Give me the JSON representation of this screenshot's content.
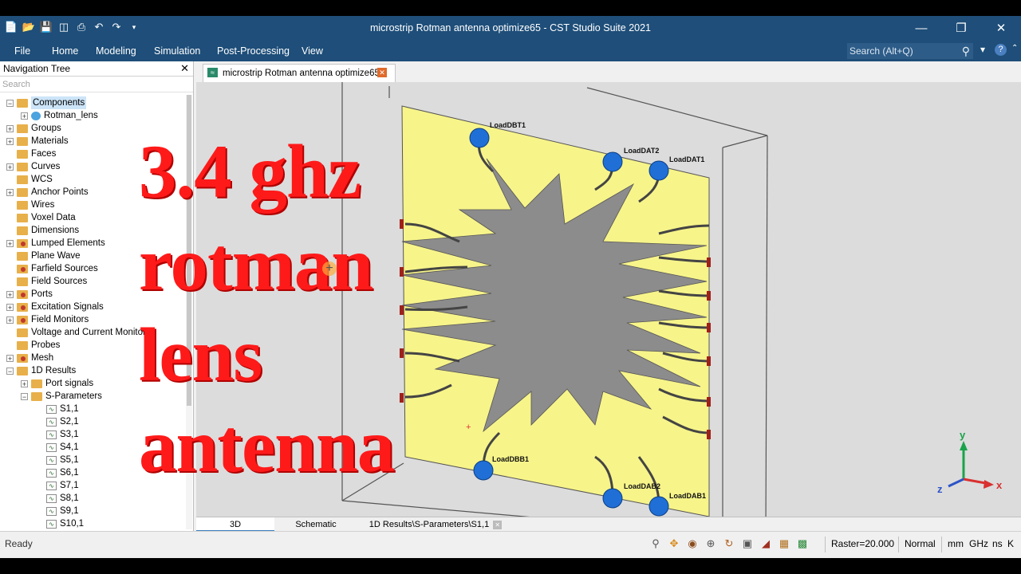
{
  "window": {
    "title": "microstrip Rotman antenna optimize65 - CST Studio Suite 2021"
  },
  "menu": {
    "items": [
      "File",
      "Home",
      "Modeling",
      "Simulation",
      "Post-Processing",
      "View"
    ],
    "search_placeholder": "Search (Alt+Q)"
  },
  "nav": {
    "title": "Navigation Tree",
    "search_placeholder": "Search",
    "items": [
      "Components",
      "Rotman_lens",
      "Groups",
      "Materials",
      "Faces",
      "Curves",
      "WCS",
      "Anchor Points",
      "Wires",
      "Voxel Data",
      "Dimensions",
      "Lumped Elements",
      "Plane Wave",
      "Farfield Sources",
      "Field Sources",
      "Ports",
      "Excitation Signals",
      "Field Monitors",
      "Voltage and Current Monitors",
      "Probes",
      "Mesh",
      "1D Results",
      "Port signals",
      "S-Parameters",
      "S1,1",
      "S2,1",
      "S3,1",
      "S4,1",
      "S5,1",
      "S6,1",
      "S7,1",
      "S8,1",
      "S9,1",
      "S10,1"
    ]
  },
  "document_tab": {
    "label": "microstrip Rotman antenna optimize65"
  },
  "viewport": {
    "port_labels": [
      "LoadDBT1",
      "LoadDAT2",
      "LoadDAT1",
      "LoadDBB1",
      "LoadDAB2",
      "LoadDAB1"
    ],
    "axes": {
      "x": "x",
      "y": "y",
      "z": "z"
    }
  },
  "overlay_text": [
    "3.4 ghz",
    "rotman",
    "lens",
    "antenna"
  ],
  "bottom_tabs": [
    "3D",
    "Schematic",
    "1D Results\\S-Parameters\\S1,1"
  ],
  "status": {
    "ready": "Ready",
    "raster": "Raster=20.000",
    "mode": "Normal",
    "units": [
      "mm",
      "GHz",
      "ns",
      "K"
    ]
  },
  "colors": {
    "ribbon": "#1e4e79",
    "substrate": "#f7f48a",
    "lens": "#8c8c8c",
    "port": "#1f6fd6",
    "overlay": "#ff1a1a"
  }
}
